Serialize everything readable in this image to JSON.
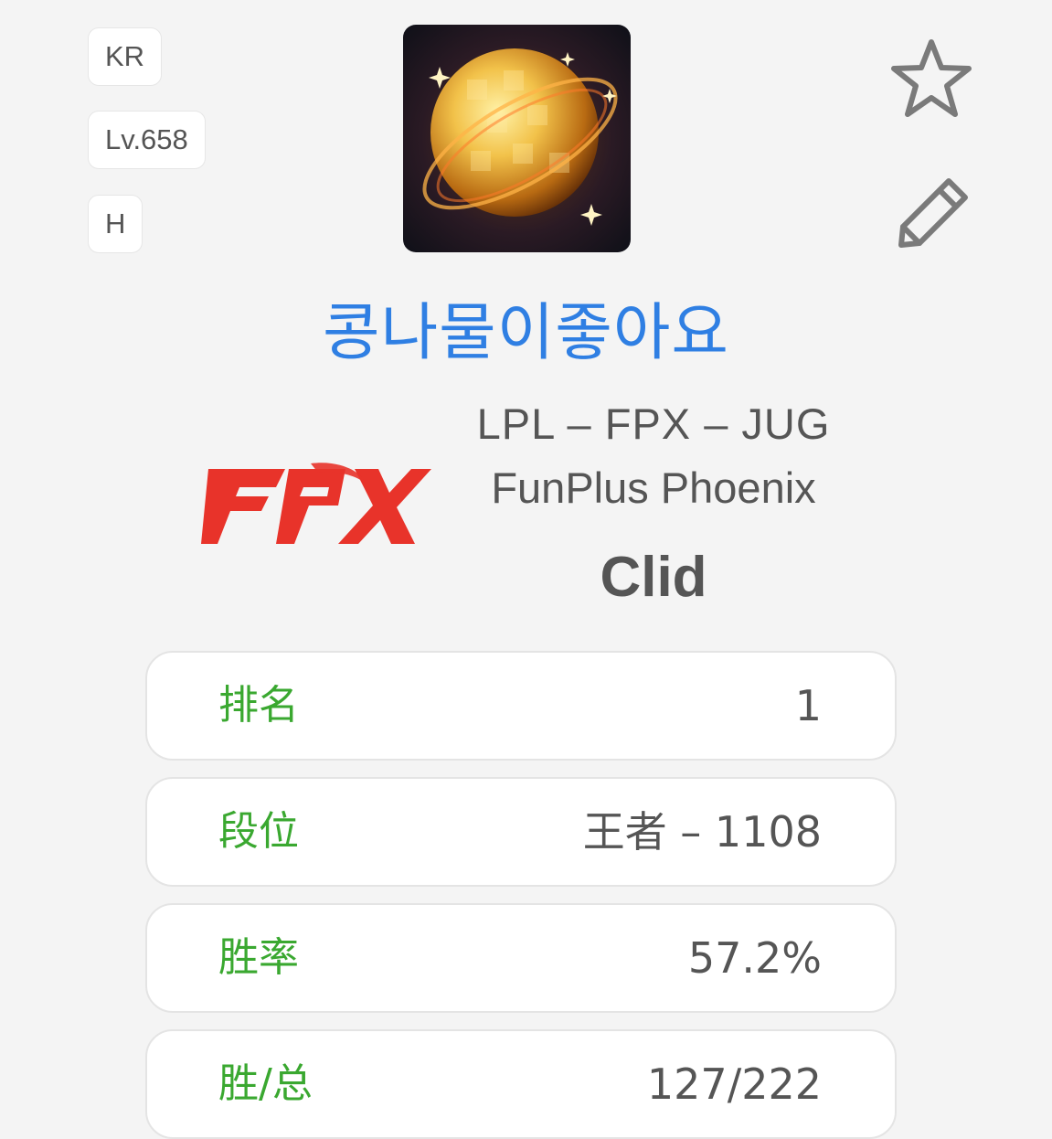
{
  "tags": {
    "region": "KR",
    "level": "Lv.658",
    "h": "H"
  },
  "header": {
    "avatar_icon": "golden-orb-profile-icon",
    "favorite_icon": "star-icon",
    "edit_icon": "pencil-icon"
  },
  "summoner_name": "콩나물이좋아요",
  "pro": {
    "league_line": "LPL – FPX – JUG",
    "team_name": "FunPlus Phoenix",
    "player": "Clid",
    "logo_text": "FPX",
    "logo_color": "#e8332a"
  },
  "stats": [
    {
      "label": "排名",
      "value": "1"
    },
    {
      "label": "段位",
      "value": "王者 – 1108"
    },
    {
      "label": "胜率",
      "value": "57.2%"
    },
    {
      "label": "胜/总",
      "value": "127/222"
    }
  ],
  "colors": {
    "name": "#2f7fe3",
    "stat_label": "#3aa830",
    "text": "#555555",
    "background": "#f4f4f4"
  }
}
